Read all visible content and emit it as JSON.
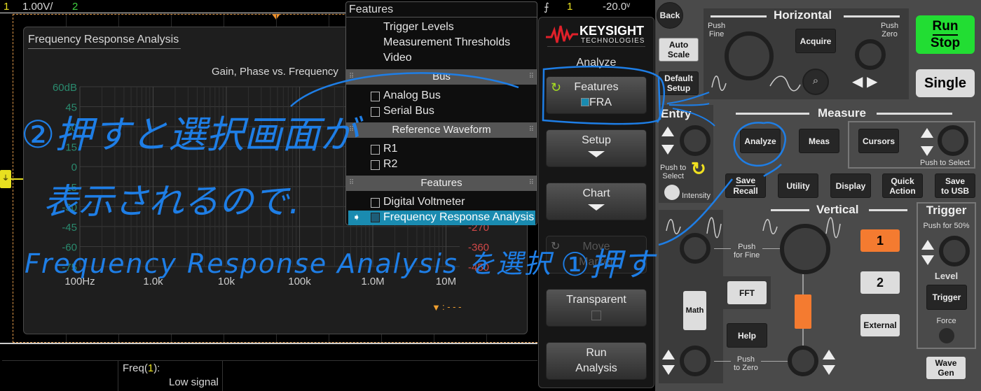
{
  "status_bar": {
    "ch1_num": "1",
    "ch1_scale": "1.00V/",
    "ch2_num": "2",
    "trigger_icon": "⨍",
    "trigger_src": "1",
    "trigger_level": "-20.0ᵛ"
  },
  "fra_window": {
    "title": "Frequency Response Analysis",
    "chart_title": "Gain, Phase vs. Frequency",
    "gain_labels": [
      "60dB",
      "45",
      "30",
      "15",
      "0",
      "-15",
      "-30",
      "-45",
      "-60",
      "-75"
    ],
    "phase_labels_visible": [
      "-270",
      "-360",
      "-450"
    ],
    "freq_labels": [
      "100Hz",
      "1.0k",
      "10k",
      "100k",
      "1.0M",
      "10M"
    ],
    "marker_readout": ": - - -"
  },
  "measurement": {
    "label_prefix": "Freq(",
    "label_ch": "1",
    "label_suffix": "):",
    "value": "Low signal"
  },
  "features_menu": {
    "title": "Features",
    "top_items": [
      "Trigger Levels",
      "Measurement Thresholds",
      "Video"
    ],
    "sections": [
      {
        "header": "Bus",
        "items": [
          "Analog Bus",
          "Serial Bus"
        ]
      },
      {
        "header": "Reference Waveform",
        "items": [
          "R1",
          "R2"
        ]
      },
      {
        "header": "Features",
        "items": [
          "Digital Voltmeter",
          "Frequency Response Analysis"
        ]
      }
    ],
    "selected": "Frequency Response Analysis"
  },
  "softkeys": {
    "brand": "KEYSIGHT",
    "brand_sub": "TECHNOLOGIES",
    "menu_title": "Analyze",
    "features_label": "Features",
    "features_value": "FRA",
    "setup": "Setup",
    "chart": "Chart",
    "move_marker_1": "Move",
    "move_marker_2": "Marker",
    "transparent": "Transparent",
    "run_analysis_1": "Run",
    "run_analysis_2": "Analysis"
  },
  "panel": {
    "back": "Back",
    "auto_scale": [
      "Auto",
      "Scale"
    ],
    "default_setup": [
      "Default",
      "Setup"
    ],
    "horizontal": "Horizontal",
    "push_fine": [
      "Push",
      "Fine"
    ],
    "acquire": "Acquire",
    "push_zero": [
      "Push",
      "Zero"
    ],
    "run": "Run",
    "stop": "Stop",
    "single": "Single",
    "entry": "Entry",
    "push_to_select": [
      "Push to",
      "Select"
    ],
    "intensity": "Intensity",
    "measure": "Measure",
    "analyze": "Analyze",
    "meas": "Meas",
    "cursors": "Cursors",
    "cursors_push": "Push to Select",
    "save_recall": [
      "Save",
      "Recall"
    ],
    "utility": "Utility",
    "display": "Display",
    "quick_action": [
      "Quick",
      "Action"
    ],
    "save_usb": [
      "Save",
      "to USB"
    ],
    "vertical": "Vertical",
    "v_push_fine": [
      "Push",
      "for Fine"
    ],
    "v_push_zero": [
      "Push",
      "to Zero"
    ],
    "ch1": "1",
    "ch2": "2",
    "external": "External",
    "fft": "FFT",
    "math": "Math",
    "help": "Help",
    "trigger": "Trigger",
    "push_50": "Push for 50%",
    "level": "Level",
    "trigger_btn": "Trigger",
    "force": "Force",
    "wave_gen": [
      "Wave",
      "Gen"
    ]
  },
  "annotations": {
    "step2_line1": "②押すと選択画面が",
    "step2_line2": "表示されるので.",
    "step2_line3": "Frequency Response Analysis を選択",
    "step1": "①押す"
  },
  "colors": {
    "accent_blue": "#1e7ee6",
    "menu_highlight": "#1a8bb0",
    "run_green": "#22dd33",
    "ch1_orange": "#f47b30",
    "gain": "#2a8a6e",
    "phase": "#d04848"
  }
}
